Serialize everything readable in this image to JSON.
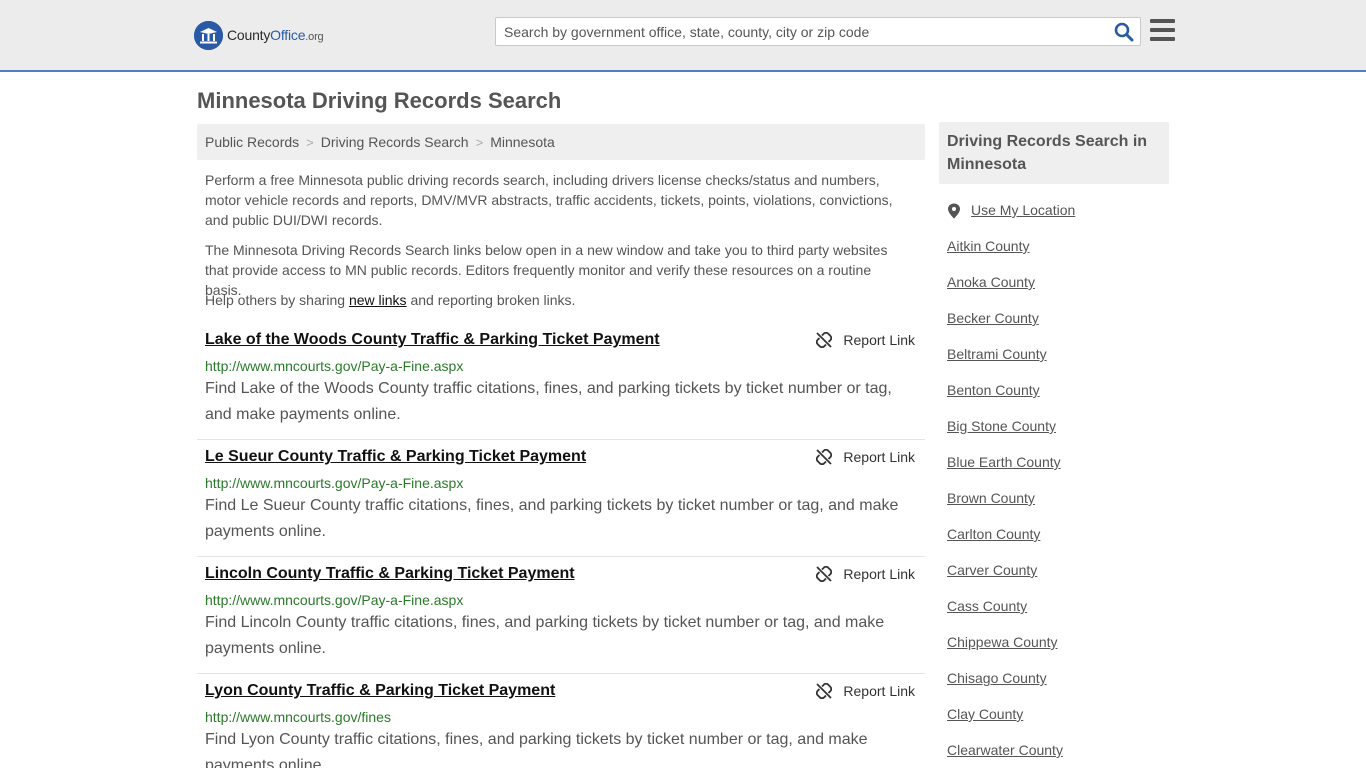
{
  "header": {
    "logo": {
      "county": "County",
      "office": "Office",
      "org": ".org"
    },
    "search": {
      "placeholder": "Search by government office, state, county, city or zip code"
    }
  },
  "page_title": "Minnesota Driving Records Search",
  "breadcrumb": [
    "Public Records",
    "Driving Records Search",
    "Minnesota"
  ],
  "intro": {
    "p1": "Perform a free Minnesota public driving records search, including drivers license checks/status and numbers, motor vehicle records and reports, DMV/MVR abstracts, traffic accidents, tickets, points, violations, convictions, and public DUI/DWI records.",
    "p2": "The Minnesota Driving Records Search links below open in a new window and take you to third party websites that provide access to MN public records. Editors frequently monitor and verify these resources on a routine basis.",
    "p3_before": "Help others by sharing ",
    "p3_link": "new links",
    "p3_after": " and reporting broken links."
  },
  "report_label": "Report Link",
  "records": [
    {
      "title": "Lake of the Woods County Traffic & Parking Ticket Payment",
      "url": "http://www.mncourts.gov/Pay-a-Fine.aspx",
      "desc": "Find Lake of the Woods County traffic citations, fines, and parking tickets by ticket number or tag, and make payments online."
    },
    {
      "title": "Le Sueur County Traffic & Parking Ticket Payment",
      "url": "http://www.mncourts.gov/Pay-a-Fine.aspx",
      "desc": "Find Le Sueur County traffic citations, fines, and parking tickets by ticket number or tag, and make payments online."
    },
    {
      "title": "Lincoln County Traffic & Parking Ticket Payment",
      "url": "http://www.mncourts.gov/Pay-a-Fine.aspx",
      "desc": "Find Lincoln County traffic citations, fines, and parking tickets by ticket number or tag, and make payments online."
    },
    {
      "title": "Lyon County Traffic & Parking Ticket Payment",
      "url": "http://www.mncourts.gov/fines",
      "desc": "Find Lyon County traffic citations, fines, and parking tickets by ticket number or tag, and make payments online."
    }
  ],
  "sidebar": {
    "heading": "Driving Records Search in Minnesota",
    "use_location": "Use My Location",
    "counties": [
      "Aitkin County",
      "Anoka County",
      "Becker County",
      "Beltrami County",
      "Benton County",
      "Big Stone County",
      "Blue Earth County",
      "Brown County",
      "Carlton County",
      "Carver County",
      "Cass County",
      "Chippewa County",
      "Chisago County",
      "Clay County",
      "Clearwater County"
    ]
  },
  "colors": {
    "accent": "#2a5aa6",
    "url_green": "#2a7a2a",
    "header_bg": "#ececec",
    "header_border": "#4f7fc0"
  }
}
